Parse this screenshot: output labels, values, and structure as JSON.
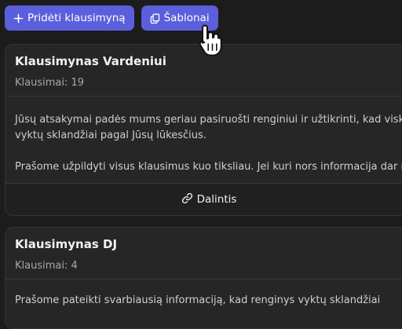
{
  "toolbar": {
    "add_label": "Pridėti klausimyną",
    "add_icon": "plus-icon",
    "templates_label": "Šablonai",
    "templates_icon": "copy-icon",
    "accent": "#5b5fdc"
  },
  "cards": [
    {
      "title": "Klausimynas Vardeniui",
      "count": "Klausimai: 19",
      "paragraphs": [
        "Jūsų atsakymai padės mums geriau pasiruošti renginiui ir užtikrinti, kad viskas",
        "vyktų sklandžiai pagal Jūsų lūkesčius.",
        "Prašome užpildyti visus klausimus kuo tiksliau. Jei kuri nors informacija dar neaiš"
      ],
      "share_label": "Dalintis",
      "share_icon": "link-icon"
    },
    {
      "title": "Klausimynas DJ",
      "count": "Klausimai: 4",
      "paragraphs": [
        "Prašome pateikti svarbiausią informaciją, kad renginys vyktų sklandžiai"
      ]
    }
  ]
}
